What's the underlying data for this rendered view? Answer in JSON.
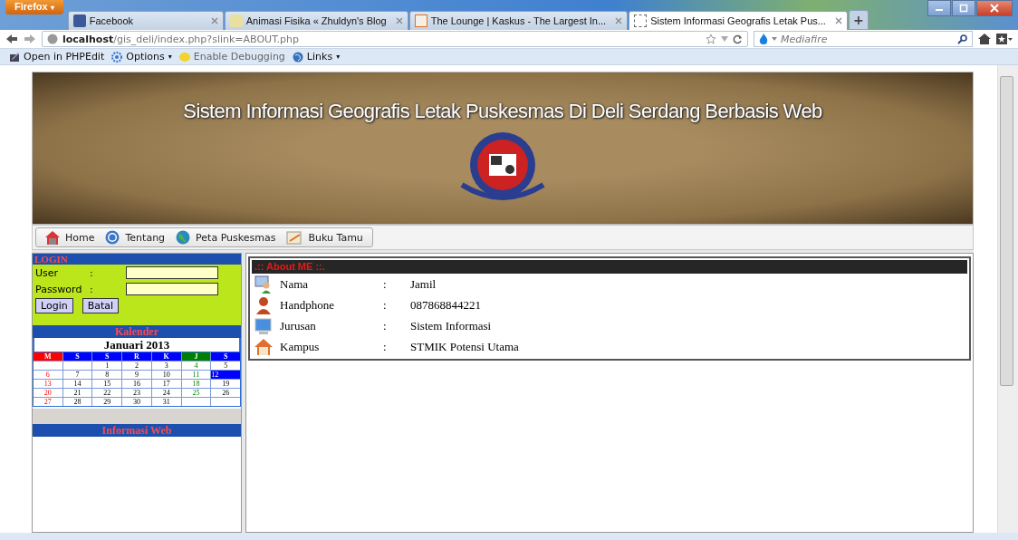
{
  "browser": {
    "menu_button": "Firefox",
    "menu_arrow": "▾",
    "tabs": [
      {
        "title": "Facebook",
        "selected": false
      },
      {
        "title": "Animasi Fisika « Zhuldyn's Blog",
        "selected": false
      },
      {
        "title": "The Lounge | Kaskus - The Largest In...",
        "selected": false
      },
      {
        "title": "Sistem Informasi Geografis Letak Pus...",
        "selected": true
      }
    ],
    "new_tab": "+",
    "url_host": "localhost",
    "url_path": "/gis_deli/index.php?slink=ABOUT.php",
    "search_placeholder": "Mediafire",
    "bookmarks": [
      {
        "label": "Open in PHPEdit",
        "disabled": false
      },
      {
        "label": "Options",
        "arrow": "▾",
        "disabled": false
      },
      {
        "label": "Enable Debugging",
        "disabled": true
      },
      {
        "label": "Links",
        "arrow": "▾",
        "disabled": false
      }
    ]
  },
  "banner": {
    "title": "Sistem Informasi Geografis Letak Puskesmas Di Deli Serdang Berbasis Web"
  },
  "nav": [
    {
      "label": "Home"
    },
    {
      "label": "Tentang"
    },
    {
      "label": "Peta Puskesmas"
    },
    {
      "label": "Buku Tamu"
    }
  ],
  "login": {
    "title": "LOGIN",
    "fields": [
      {
        "label": "User",
        "colon": ":"
      },
      {
        "label": "Password",
        "colon": ":"
      }
    ],
    "buttons": [
      "Login",
      "Batal"
    ]
  },
  "calendar": {
    "title": "Kalender",
    "month": "Januari 2013",
    "days": [
      {
        "label": "M",
        "color": "#ff0000"
      },
      {
        "label": "S",
        "color": "#0000ff"
      },
      {
        "label": "S",
        "color": "#0000ff"
      },
      {
        "label": "R",
        "color": "#0000ff"
      },
      {
        "label": "K",
        "color": "#0000ff"
      },
      {
        "label": "J",
        "color": "#008000"
      },
      {
        "label": "S",
        "color": "#0000ff"
      }
    ],
    "weeks": [
      [
        {
          "kind": "blank"
        },
        {
          "kind": "blank"
        },
        {
          "kind": "day",
          "day": "1",
          "selected": false
        },
        {
          "kind": "day",
          "day": "2",
          "selected": false
        },
        {
          "kind": "day",
          "day": "3",
          "selected": false
        },
        {
          "kind": "day",
          "day": "4",
          "selected": false
        },
        {
          "kind": "day",
          "day": "5",
          "selected": false
        }
      ],
      [
        {
          "kind": "day",
          "day": "6",
          "selected": false
        },
        {
          "kind": "day",
          "day": "7",
          "selected": false
        },
        {
          "kind": "day",
          "day": "8",
          "selected": false
        },
        {
          "kind": "day",
          "day": "9",
          "selected": false
        },
        {
          "kind": "day",
          "day": "10",
          "selected": false
        },
        {
          "kind": "day",
          "day": "11",
          "selected": false
        },
        {
          "kind": "day",
          "day": "12",
          "selected": true
        }
      ],
      [
        {
          "kind": "day",
          "day": "13",
          "selected": false
        },
        {
          "kind": "day",
          "day": "14",
          "selected": false
        },
        {
          "kind": "day",
          "day": "15",
          "selected": false
        },
        {
          "kind": "day",
          "day": "16",
          "selected": false
        },
        {
          "kind": "day",
          "day": "17",
          "selected": false
        },
        {
          "kind": "day",
          "day": "18",
          "selected": false
        },
        {
          "kind": "day",
          "day": "19",
          "selected": false
        }
      ],
      [
        {
          "kind": "day",
          "day": "20",
          "selected": false
        },
        {
          "kind": "day",
          "day": "21",
          "selected": false
        },
        {
          "kind": "day",
          "day": "22",
          "selected": false
        },
        {
          "kind": "day",
          "day": "23",
          "selected": false
        },
        {
          "kind": "day",
          "day": "24",
          "selected": false
        },
        {
          "kind": "day",
          "day": "25",
          "selected": false
        },
        {
          "kind": "day",
          "day": "26",
          "selected": false
        }
      ],
      [
        {
          "kind": "day",
          "day": "27",
          "selected": false
        },
        {
          "kind": "day",
          "day": "28",
          "selected": false
        },
        {
          "kind": "day",
          "day": "29",
          "selected": false
        },
        {
          "kind": "day",
          "day": "30",
          "selected": false
        },
        {
          "kind": "day",
          "day": "31",
          "selected": false
        },
        {
          "kind": "blank"
        },
        {
          "kind": "blank"
        }
      ]
    ]
  },
  "info": {
    "title": "Informasi Web"
  },
  "about": {
    "title": ".:: About ME ::.",
    "rows": [
      {
        "label": "Nama",
        "colon": ":",
        "value": "Jamil"
      },
      {
        "label": "Handphone",
        "colon": ":",
        "value": "087868844221"
      },
      {
        "label": "Jurusan",
        "colon": ":",
        "value": "Sistem Informasi"
      },
      {
        "label": "Kampus",
        "colon": ":",
        "value": "STMIK Potensi Utama"
      }
    ]
  }
}
